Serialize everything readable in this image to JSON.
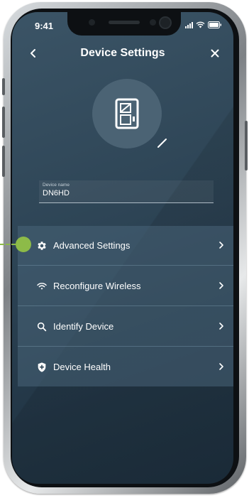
{
  "status_bar": {
    "time": "9:41"
  },
  "header": {
    "title": "Device Settings"
  },
  "device_name_field": {
    "label": "Device name",
    "value": "DN6HD"
  },
  "menu": {
    "items": [
      {
        "label": "Advanced Settings",
        "icon": "gear-icon"
      },
      {
        "label": "Reconfigure Wireless",
        "icon": "wifi-icon"
      },
      {
        "label": "Identify Device",
        "icon": "search-icon"
      },
      {
        "label": "Device Health",
        "icon": "shield-icon"
      }
    ]
  },
  "colors": {
    "screen_bg": "#2d4455",
    "menu_bg": "#486579",
    "callout": "#8dbb48",
    "text": "#ffffff"
  }
}
